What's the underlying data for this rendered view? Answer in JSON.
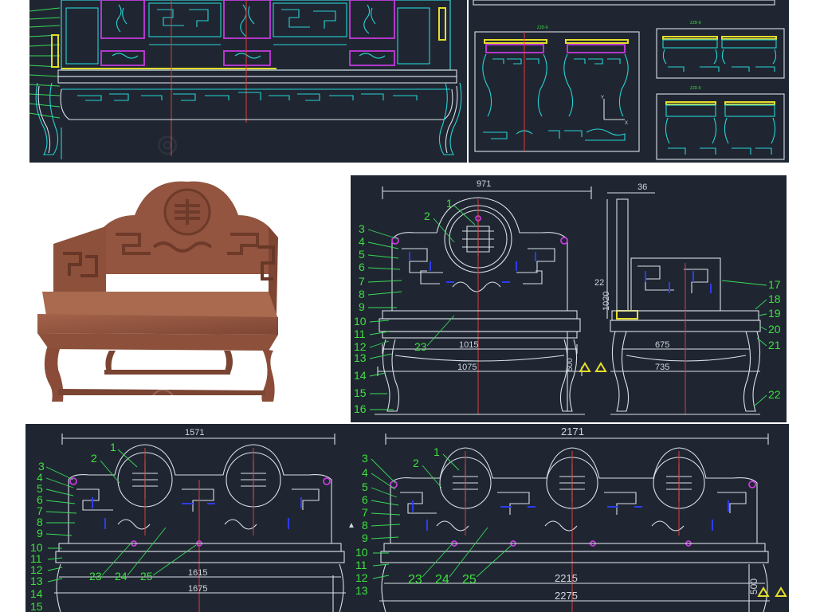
{
  "top_left_drawing": {
    "type": "front elevation with carved panels"
  },
  "top_right_drawing": {
    "sub_labels": [
      "ZJD-6",
      "ZJD-6",
      "ZJD-6"
    ]
  },
  "side_elevation_small": {
    "label": "Y",
    "axis2": "X"
  },
  "chair_photo": {
    "description_visible": false
  },
  "single_seat_drawing": {
    "dimensions": {
      "overall_width": "971",
      "seat_width": "1015",
      "base_width": "1075",
      "height": "1020",
      "seat_height": "500",
      "back_top": "22",
      "side_depth_top": "36",
      "side_seat_depth": "675",
      "side_base_depth": "735"
    },
    "callouts_left": [
      "1",
      "2",
      "3",
      "4",
      "5",
      "6",
      "7",
      "8",
      "9",
      "10",
      "11",
      "12",
      "13",
      "14",
      "15",
      "16"
    ],
    "callouts_right": [
      "17",
      "18",
      "19",
      "20",
      "21",
      "22"
    ],
    "callout_23": "23"
  },
  "double_seat_drawing": {
    "dimensions": {
      "overall_width": "1571",
      "seat_width": "1615",
      "base_width": "1675"
    },
    "callouts_left": [
      "1",
      "2",
      "3",
      "4",
      "5",
      "6",
      "7",
      "8",
      "9",
      "10",
      "11",
      "12",
      "13",
      "14",
      "15"
    ],
    "callouts_bottom": [
      "23",
      "24",
      "25"
    ]
  },
  "triple_seat_drawing": {
    "dimensions": {
      "overall_width": "2171",
      "seat_width": "2215",
      "base_width": "2275",
      "seat_height": "500"
    },
    "callouts_left": [
      "1",
      "2",
      "3",
      "4",
      "5",
      "6",
      "7",
      "8",
      "9",
      "10",
      "11",
      "12",
      "13"
    ],
    "callouts_bottom": [
      "23",
      "24",
      "25"
    ]
  },
  "colors": {
    "background": "#1f2631",
    "cyan": "#27d3d6",
    "white": "#d9e0e8",
    "blue": "#2d3cf0",
    "green": "#39d95a",
    "red": "#e23a3a",
    "magenta": "#c43bdc",
    "yellow": "#e5dd2c"
  }
}
